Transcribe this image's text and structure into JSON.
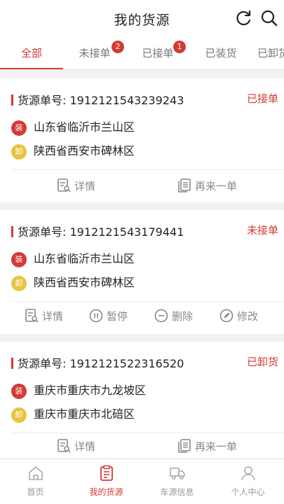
{
  "header": {
    "title": "我的货源"
  },
  "tabs": [
    {
      "label": "全部",
      "active": true
    },
    {
      "label": "未接单",
      "badge": "2"
    },
    {
      "label": "已接单",
      "badge": "1"
    },
    {
      "label": "已装货"
    },
    {
      "label": "已卸货"
    }
  ],
  "cards": [
    {
      "order_label": "货源单号:",
      "order_no": "1912121543239243",
      "status": "已接单",
      "load_tag": "装",
      "load_addr": "山东省临沂市兰山区",
      "unload_tag": "卸",
      "unload_addr": "陕西省西安市碑林区",
      "actions": [
        "详情",
        "再来一单"
      ]
    },
    {
      "order_label": "货源单号:",
      "order_no": "1912121543179441",
      "status": "未接单",
      "load_tag": "装",
      "load_addr": "山东省临沂市兰山区",
      "unload_tag": "卸",
      "unload_addr": "陕西省西安市碑林区",
      "actions": [
        "详情",
        "暂停",
        "删除",
        "修改"
      ]
    },
    {
      "order_label": "货源单号:",
      "order_no": "1912121522316520",
      "status": "已卸货",
      "load_tag": "装",
      "load_addr": "重庆市重庆市九龙坡区",
      "unload_tag": "卸",
      "unload_addr": "重庆市重庆市北碚区",
      "actions": [
        "详情",
        "再来一单"
      ]
    }
  ],
  "tabbar": [
    {
      "label": "首页",
      "icon": "home-icon"
    },
    {
      "label": "我的货源",
      "icon": "clipboard-icon",
      "active": true
    },
    {
      "label": "车源信息",
      "icon": "truck-icon"
    },
    {
      "label": "个人中心",
      "icon": "person-icon"
    }
  ],
  "colors": {
    "accent": "#d43a34",
    "unload": "#e6c441"
  }
}
